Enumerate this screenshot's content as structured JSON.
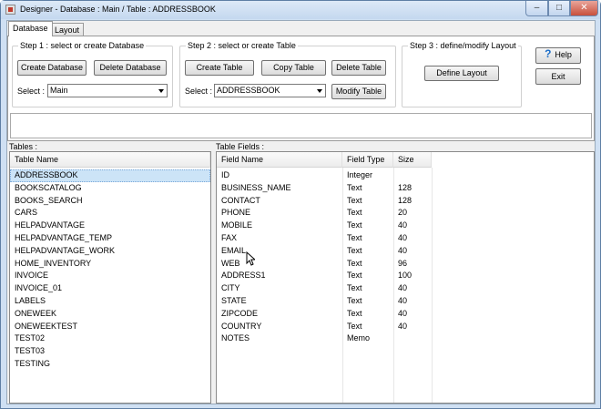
{
  "window": {
    "title": "Designer - Database : Main / Table : ADDRESSBOOK",
    "minimize": "–",
    "maximize": "□",
    "close": "✕"
  },
  "tabs": [
    {
      "label": "Database",
      "active": true
    },
    {
      "label": "Layout",
      "active": false
    }
  ],
  "step1": {
    "title": "Step 1 : select or create Database",
    "create_label": "Create Database",
    "delete_label": "Delete Database",
    "select_label": "Select :",
    "select_value": "Main"
  },
  "step2": {
    "title": "Step 2 : select or create Table",
    "create_label": "Create Table",
    "copy_label": "Copy Table",
    "delete_label": "Delete Table",
    "select_label": "Select :",
    "select_value": "ADDRESSBOOK",
    "modify_label": "Modify Table"
  },
  "step3": {
    "title": "Step 3 : define/modify Layout",
    "define_label": "Define Layout"
  },
  "help_label": "Help",
  "exit_label": "Exit",
  "tables": {
    "label": "Tables :",
    "header": "Table Name",
    "selected_index": 0,
    "items": [
      "ADDRESSBOOK",
      "BOOKSCATALOG",
      "BOOKS_SEARCH",
      "CARS",
      "HELPADVANTAGE",
      "HELPADVANTAGE_TEMP",
      "HELPADVANTAGE_WORK",
      "HOME_INVENTORY",
      "INVOICE",
      "INVOICE_01",
      "LABELS",
      "ONEWEEK",
      "ONEWEEKTEST",
      "TEST02",
      "TEST03",
      "TESTING"
    ]
  },
  "fields": {
    "label": "Table Fields :",
    "headers": [
      "Field Name",
      "Field Type",
      "Size"
    ],
    "rows": [
      [
        "ID",
        "Integer",
        ""
      ],
      [
        "BUSINESS_NAME",
        "Text",
        "128"
      ],
      [
        "CONTACT",
        "Text",
        "128"
      ],
      [
        "PHONE",
        "Text",
        "20"
      ],
      [
        "MOBILE",
        "Text",
        "40"
      ],
      [
        "FAX",
        "Text",
        "40"
      ],
      [
        "EMAIL",
        "Text",
        "40"
      ],
      [
        "WEB",
        "Text",
        "96"
      ],
      [
        "ADDRESS1",
        "Text",
        "100"
      ],
      [
        "CITY",
        "Text",
        "40"
      ],
      [
        "STATE",
        "Text",
        "40"
      ],
      [
        "ZIPCODE",
        "Text",
        "40"
      ],
      [
        "COUNTRY",
        "Text",
        "40"
      ],
      [
        "NOTES",
        "Memo",
        ""
      ]
    ]
  }
}
